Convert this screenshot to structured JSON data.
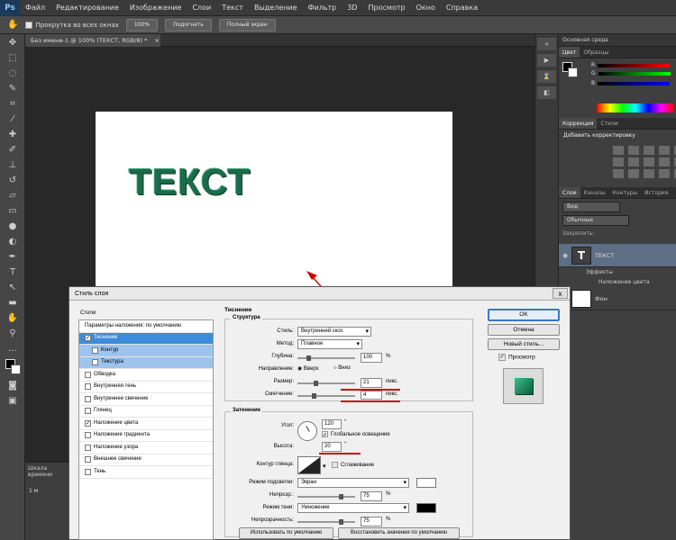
{
  "app": {
    "logo": "Ps"
  },
  "menu": [
    "Файл",
    "Редактирование",
    "Изображение",
    "Слои",
    "Текст",
    "Выделение",
    "Фильтр",
    "3D",
    "Просмотр",
    "Окно",
    "Справка"
  ],
  "options_bar": {
    "scroll_all": "Прокрутка во всех окнах",
    "zoom": "100%",
    "fit": "Подогнать",
    "fullscreen": "Полный экран"
  },
  "document_tab": "Без имени-1 @ 100% (ТЕКСТ, RGB/8) *",
  "canvas": {
    "text": "ТЕКСТ",
    "text_color": "#1c6b4a"
  },
  "timeline": {
    "title": "Шкала времени",
    "time": "1 м"
  },
  "panels": {
    "color_tabs": [
      "Цвет",
      "Образцы"
    ],
    "color_labels": [
      "R",
      "G",
      "B"
    ],
    "workspace": "Основная среда",
    "adjust_tabs": [
      "Коррекция",
      "Стили"
    ],
    "adjust_title": "Добавить корректировку",
    "layers_tabs": [
      "Слои",
      "Каналы",
      "Контуры",
      "История"
    ],
    "kind_filter": "Вид",
    "blend_mode": "Обычные",
    "lock_label": "Закрепить:",
    "layers": [
      {
        "name": "ТЕКСТ",
        "thumb": "T",
        "effects_label": "Эффекты",
        "effect": "Наложение цвета"
      },
      {
        "name": "Фон",
        "thumb": ""
      }
    ]
  },
  "dialog": {
    "title": "Стиль слоя",
    "close": "x",
    "styles_header": "Стили",
    "styles": [
      {
        "label": "Параметры наложения: по умолчанию",
        "check": null,
        "state": "plain"
      },
      {
        "label": "Тиснение",
        "check": "✓",
        "state": "sel"
      },
      {
        "label": "Контур",
        "check": "",
        "state": "sub"
      },
      {
        "label": "Текстура",
        "check": "",
        "state": "sub"
      },
      {
        "label": "Обводка",
        "check": "",
        "state": "plain"
      },
      {
        "label": "Внутренняя тень",
        "check": "",
        "state": "plain"
      },
      {
        "label": "Внутреннее свечение",
        "check": "",
        "state": "plain"
      },
      {
        "label": "Глянец",
        "check": "",
        "state": "plain"
      },
      {
        "label": "Наложение цвета",
        "check": "✓",
        "state": "plain"
      },
      {
        "label": "Наложение градиента",
        "check": "",
        "state": "plain"
      },
      {
        "label": "Наложение узора",
        "check": "",
        "state": "plain"
      },
      {
        "label": "Внешнее свечение",
        "check": "",
        "state": "plain"
      },
      {
        "label": "Тень",
        "check": "",
        "state": "plain"
      }
    ],
    "bevel": {
      "title": "Тиснение",
      "structure_title": "Структура",
      "style_label": "Стиль:",
      "style_value": "Внутренний скос",
      "method_label": "Метод:",
      "method_value": "Плавное",
      "depth_label": "Глубина:",
      "depth_value": "100",
      "depth_unit": "%",
      "direction_label": "Направление:",
      "dir_up": "Вверх",
      "dir_down": "Вниз",
      "size_label": "Размер:",
      "size_value": "21",
      "size_unit": "пикс.",
      "soften_label": "Смягчение:",
      "soften_value": "4",
      "soften_unit": "пикс."
    },
    "shading": {
      "title": "Затенение",
      "angle_label": "Угол:",
      "angle_value": "120",
      "angle_unit": "°",
      "global_light": "Глобальное освещение",
      "altitude_label": "Высота:",
      "altitude_value": "20",
      "altitude_unit": "°",
      "gloss_label": "Контур глянца:",
      "antialias": "Сглаживание",
      "highlight_label": "Режим подсветки:",
      "highlight_value": "Экран",
      "highlight_opacity_label": "Непрозр.:",
      "highlight_opacity": "75",
      "highlight_color": "#ffffff",
      "shadow_label": "Режим тени:",
      "shadow_value": "Умножение",
      "shadow_opacity_label": "Непрозрачность:",
      "shadow_opacity": "75",
      "shadow_color": "#000000",
      "pct": "%"
    },
    "buttons": {
      "ok": "OK",
      "cancel": "Отмена",
      "new_style": "Новый стиль...",
      "preview": "Просмотр",
      "make_default": "Использовать по умолчанию",
      "reset_default": "Восстановить значения по умолчанию"
    }
  }
}
